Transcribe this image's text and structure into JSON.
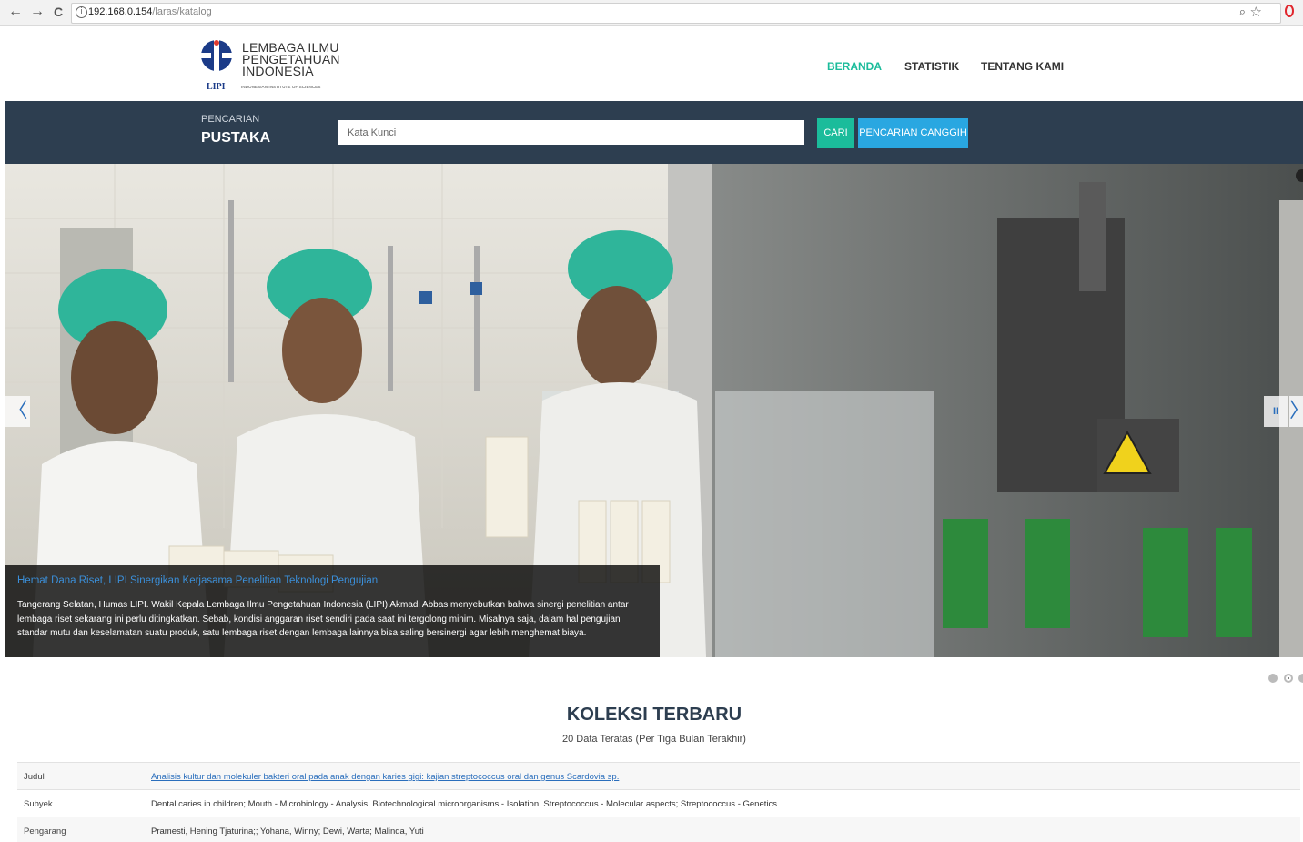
{
  "browser": {
    "back": "←",
    "forward": "→",
    "reload": "C",
    "url_host": "192.168.0.154",
    "url_path": "/laras/katalog",
    "zoom_icon": "zoom-icon",
    "star_icon": "bookmark-star-icon"
  },
  "header": {
    "logo": {
      "line1": "LEMBAGA ILMU",
      "line2": "PENGETAHUAN",
      "line3": "INDONESIA",
      "abbr": "LIPI",
      "sub": "INDONESIAN INSTITUTE OF SCIENCES"
    },
    "nav": [
      {
        "label": "BERANDA",
        "active": true
      },
      {
        "label": "STATISTIK",
        "active": false
      },
      {
        "label": "TENTANG KAMI",
        "active": false
      }
    ]
  },
  "search": {
    "small_label": "PENCARIAN",
    "big_label": "PUSTAKA",
    "placeholder": "Kata Kunci",
    "cari_label": "CARI",
    "advanced_label": "PENCARIAN CANGGIH"
  },
  "slider": {
    "title": "Hemat Dana Riset, LIPI Sinergikan Kerjasama Penelitian Teknologi Pengujian",
    "body": "Tangerang Selatan, Humas LIPI. Wakil Kepala Lembaga Ilmu Pengetahuan Indonesia (LIPI) Akmadi Abbas menyebutkan bahwa sinergi penelitian antar lembaga riset sekarang ini perlu ditingkatkan. Sebab, kondisi anggaran riset sendiri pada saat ini tergolong minim. Misalnya saja, dalam hal pengujian standar mutu dan keselamatan suatu produk, satu lembaga riset dengan lembaga lainnya bisa saling bersinergi agar lebih menghemat biaya.",
    "prev": "〈",
    "next": "〉",
    "pause": "II",
    "active_slide": 2
  },
  "collection": {
    "title": "KOLEKSI TERBARU",
    "subtitle": "20 Data Teratas (Per Tiga Bulan Terakhir)",
    "rows": [
      {
        "key": "Judul",
        "value": "Analisis kultur dan molekuler bakteri oral pada anak dengan karies gigi: kajian streptococcus oral dan genus Scardovia sp."
      },
      {
        "key": "Subyek",
        "value": "Dental caries in children; Mouth - Microbiology - Analysis; Biotechnological microorganisms - Isolation; Streptococcus - Molecular aspects; Streptococcus - Genetics"
      },
      {
        "key": "Pengarang",
        "value": "Pramesti, Hening Tjaturina;; Yohana, Winny; Dewi, Warta; Malinda, Yuti"
      }
    ]
  },
  "colors": {
    "accent_green": "#1bbc9b",
    "accent_blue": "#29a7e1",
    "navy": "#2d3e50"
  }
}
